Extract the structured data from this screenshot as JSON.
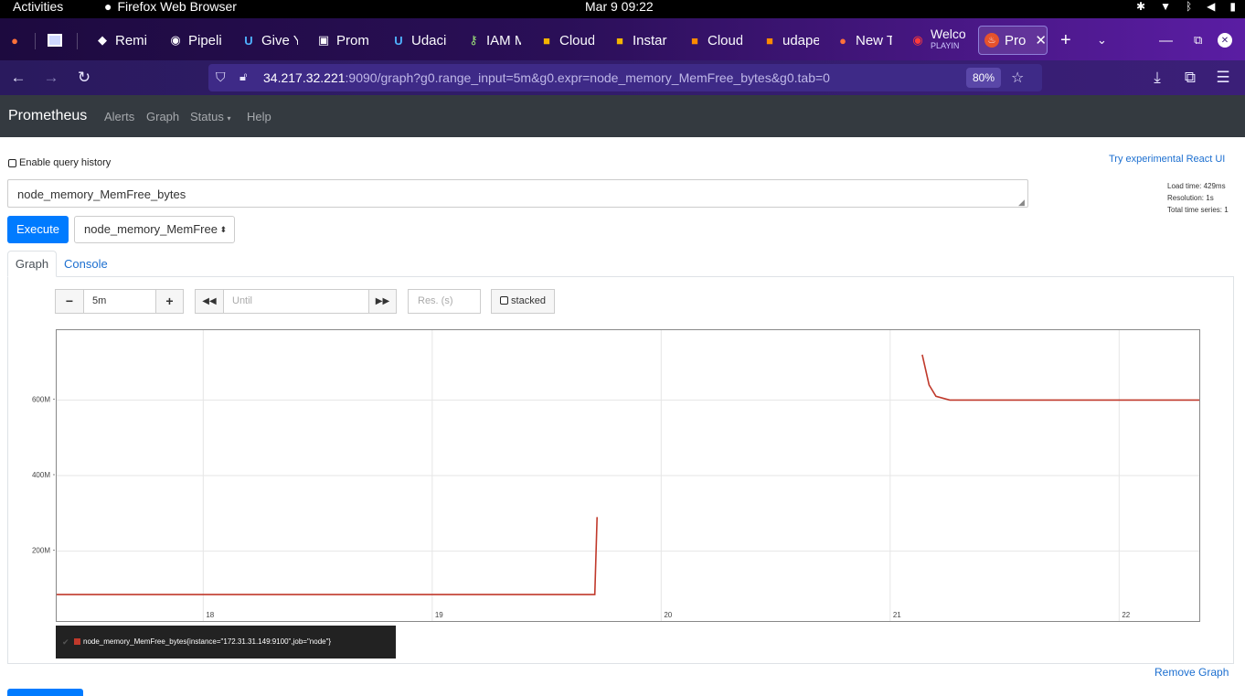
{
  "os": {
    "activities": "Activities",
    "app_name": "Firefox Web Browser",
    "clock": "Mar 9  09:22"
  },
  "browser": {
    "tabs": [
      {
        "label": "",
        "icon": "firefox-icon"
      },
      {
        "label": "",
        "icon": "window-icon"
      },
      {
        "label": "Remi",
        "icon": "remix-icon"
      },
      {
        "label": "Pipeli",
        "icon": "circleci-icon"
      },
      {
        "label": "Give Y",
        "icon": "udacity-icon"
      },
      {
        "label": "Prom",
        "icon": "terminal-icon"
      },
      {
        "label": "Udaci",
        "icon": "udacity-icon"
      },
      {
        "label": "IAM M",
        "icon": "key-icon"
      },
      {
        "label": "Cloud",
        "icon": "aws-box-icon"
      },
      {
        "label": "Instar",
        "icon": "aws-box-icon"
      },
      {
        "label": "Cloud",
        "icon": "cube-icon"
      },
      {
        "label": "udape",
        "icon": "cube-icon"
      },
      {
        "label": "New T",
        "icon": "firefox-icon"
      },
      {
        "label": "Welco",
        "sublabel": "PLAYIN",
        "icon": "youtube-icon"
      },
      {
        "label": "Pro",
        "icon": "prometheus-icon",
        "active": true
      }
    ],
    "url_host": "34.217.32.221",
    "url_rest": ":9090/graph?g0.range_input=5m&g0.expr=node_memory_MemFree_bytes&g0.tab=0",
    "zoom": "80%"
  },
  "prom": {
    "brand": "Prometheus",
    "nav": [
      "Alerts",
      "Graph",
      "Status",
      "Help"
    ],
    "query_history_label": "Enable query history",
    "react_link": "Try experimental React UI",
    "expression": "node_memory_MemFree_bytes",
    "stats": {
      "load_time": "Load time: 429ms",
      "resolution": "Resolution: 1s",
      "total_series": "Total time series: 1"
    },
    "execute_label": "Execute",
    "metric_select": "node_memory_MemFree",
    "tabs": {
      "graph": "Graph",
      "console": "Console"
    },
    "controls": {
      "range": "5m",
      "until_placeholder": "Until",
      "res_placeholder": "Res. (s)",
      "stacked_label": "stacked"
    },
    "legend_text": "node_memory_MemFree_bytes{instance=\"172.31.31.149:9100\",job=\"node\"}",
    "remove_graph": "Remove Graph"
  },
  "chart_data": {
    "type": "line",
    "series_color": "#c0392b",
    "y_ticks": [
      {
        "value": 200,
        "label": "200M"
      },
      {
        "value": 400,
        "label": "400M"
      },
      {
        "value": 600,
        "label": "600M"
      }
    ],
    "x_ticks": [
      {
        "value": 18,
        "label": "18"
      },
      {
        "value": 19,
        "label": "19"
      },
      {
        "value": 20,
        "label": "20"
      },
      {
        "value": 21,
        "label": "21"
      },
      {
        "value": 22,
        "label": "22"
      }
    ],
    "xlim": [
      17.36,
      22.35
    ],
    "ylim": [
      15,
      785
    ],
    "series": [
      {
        "name": "node_memory_MemFree_bytes{instance=\"172.31.31.149:9100\",job=\"node\"}",
        "segments": [
          [
            [
              17.36,
              85
            ],
            [
              19.71,
              85
            ],
            [
              19.72,
              290
            ]
          ],
          [
            [
              21.14,
              720
            ],
            [
              21.17,
              640
            ],
            [
              21.2,
              610
            ],
            [
              21.26,
              600
            ],
            [
              22.35,
              600
            ]
          ]
        ]
      }
    ]
  }
}
